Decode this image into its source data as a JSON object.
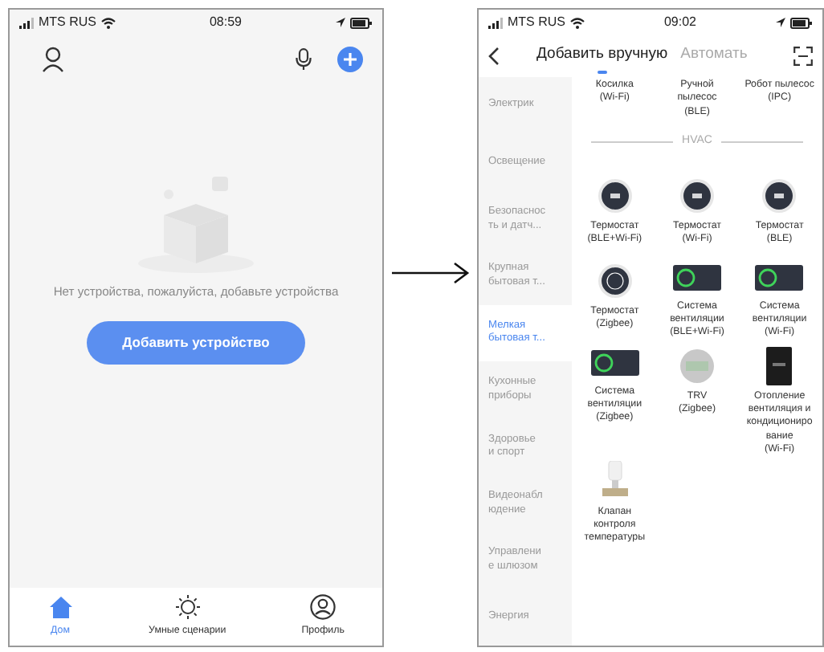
{
  "home_screen": {
    "status_bar": {
      "carrier": "MTS RUS",
      "time": "08:59"
    },
    "empty_message": "Нет устройства, пожалуйста, добавьте устройства",
    "add_button": "Добавить устройство",
    "tab_bar": [
      {
        "label": "Дом",
        "kind": "home",
        "selected": true
      },
      {
        "label": "Умные сценарии",
        "kind": "scenes",
        "selected": false
      },
      {
        "label": "Профиль",
        "kind": "profile",
        "selected": false
      }
    ]
  },
  "add_device_screen": {
    "status_bar": {
      "carrier": "MTS RUS",
      "time": "09:02"
    },
    "tabs": [
      {
        "label": "Добавить вручную",
        "selected": true
      },
      {
        "label": "Автомать",
        "selected": false
      }
    ],
    "categories": [
      {
        "label": "Электрик",
        "selected": false
      },
      {
        "label": "Освещение",
        "selected": false
      },
      {
        "label": "Безопаснос\nть и датч...",
        "selected": false
      },
      {
        "label": "Крупная\nбытовая т...",
        "selected": false
      },
      {
        "label": "Мелкая\nбытовая т...",
        "selected": true
      },
      {
        "label": "Кухонные\nприборы",
        "selected": false
      },
      {
        "label": "Здоровье\nи спорт",
        "selected": false
      },
      {
        "label": "Видеонабл\nюдение",
        "selected": false
      },
      {
        "label": "Управлени\nе шлюзом",
        "selected": false
      },
      {
        "label": "Энергия",
        "selected": false
      }
    ],
    "top_devices": [
      {
        "label": "Косилка\n(Wi-Fi)"
      },
      {
        "label": "Ручной\nпылесос\n(BLE)"
      },
      {
        "label": "Робот пылесос\n(IPC)"
      }
    ],
    "section_title": "HVAC",
    "devices": [
      {
        "label": "Термостат\n(BLE+Wi-Fi)",
        "kind": "round"
      },
      {
        "label": "Термостат\n(Wi-Fi)",
        "kind": "round"
      },
      {
        "label": "Термостат\n(BLE)",
        "kind": "round"
      },
      {
        "label": "Термостат\n(Zigbee)",
        "kind": "round-white"
      },
      {
        "label": "Система\nвентиляции\n(BLE+Wi-Fi)",
        "kind": "panel"
      },
      {
        "label": "Система\nвентиляции\n(Wi-Fi)",
        "kind": "panel"
      },
      {
        "label": "Система\nвентиляции\n(Zigbee)",
        "kind": "panel"
      },
      {
        "label": "TRV\n(Zigbee)",
        "kind": "trv"
      },
      {
        "label": "Отопление\nвентиляция и\nкондициониро\nвание\n(Wi-Fi)",
        "kind": "tall"
      },
      {
        "label": "Клапан\nконтроля\nтемпературы",
        "kind": "valve"
      }
    ]
  }
}
